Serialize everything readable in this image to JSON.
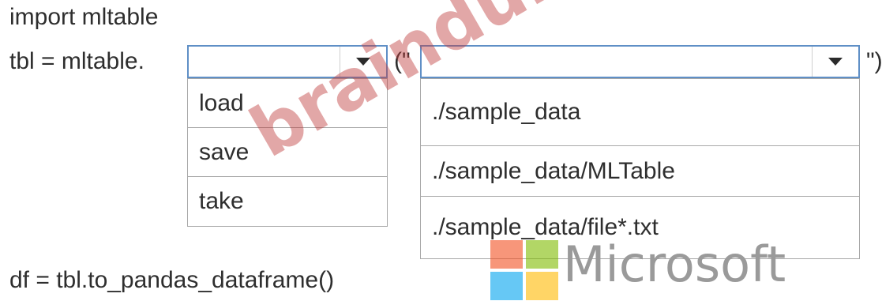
{
  "code": {
    "line1": "import mltable",
    "line2_prefix": "tbl = mltable.",
    "paren_open": "(\"",
    "paren_close": "\")",
    "line3": "df = tbl.to_pandas_dataframe()"
  },
  "method_dropdown": {
    "selected": "",
    "options": [
      "load",
      "save",
      "take"
    ]
  },
  "path_dropdown": {
    "selected": "",
    "options": [
      "./sample_data",
      "./sample_data/MLTable",
      "./sample_data/file*.txt"
    ]
  },
  "watermark": "braindumpsit.com",
  "branding": {
    "name": "Microsoft",
    "logo_colors": [
      "#f25022",
      "#7fba00",
      "#00a4ef",
      "#ffb900"
    ]
  }
}
